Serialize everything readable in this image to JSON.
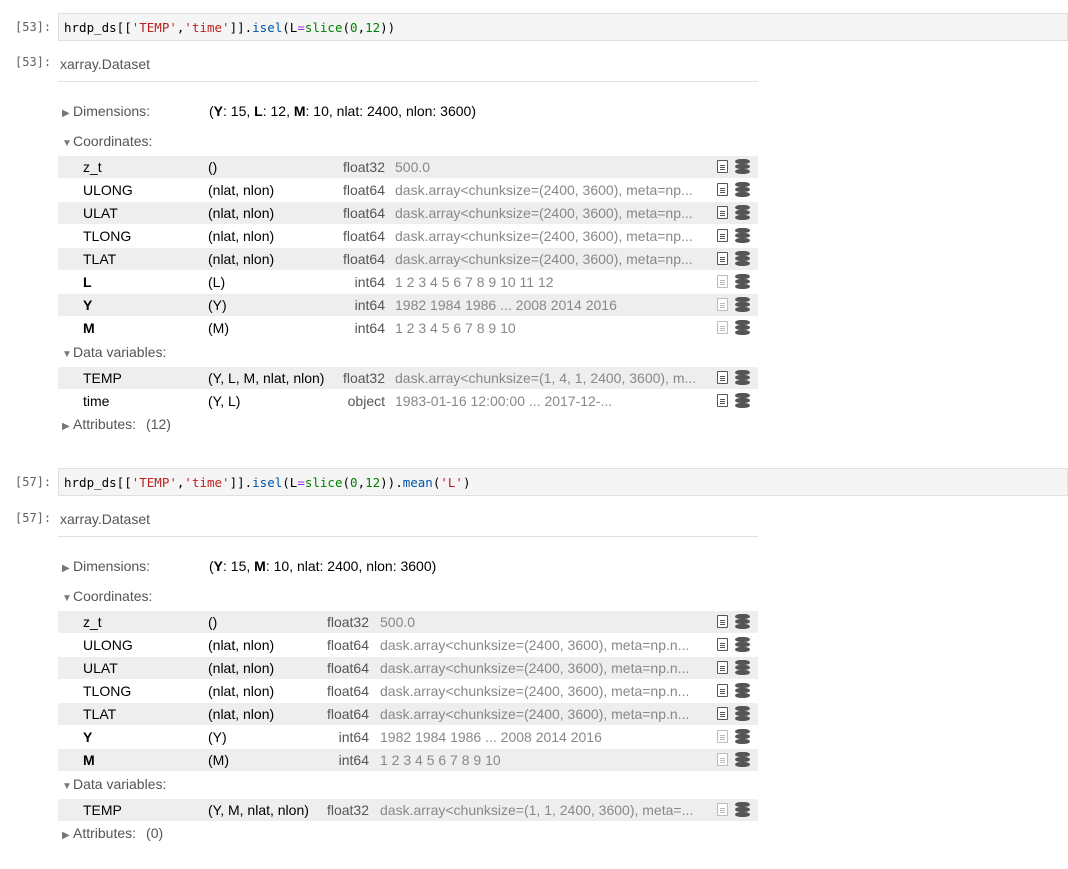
{
  "cells": [
    {
      "in_prompt": "[53]:",
      "out_prompt": "[53]:",
      "code_parts": [
        {
          "t": "hrdp_ds[[",
          "c": ""
        },
        {
          "t": "'TEMP'",
          "c": "c-str"
        },
        {
          "t": ",",
          "c": ""
        },
        {
          "t": "'time'",
          "c": "c-str"
        },
        {
          "t": "]].",
          "c": ""
        },
        {
          "t": "isel",
          "c": "c-fn"
        },
        {
          "t": "(L",
          "c": ""
        },
        {
          "t": "=",
          "c": "c-kw"
        },
        {
          "t": "slice",
          "c": "c-num"
        },
        {
          "t": "(",
          "c": ""
        },
        {
          "t": "0",
          "c": "c-num"
        },
        {
          "t": ",",
          "c": ""
        },
        {
          "t": "12",
          "c": "c-num"
        },
        {
          "t": "))",
          "c": ""
        }
      ],
      "output_title": "xarray.Dataset",
      "dimensions_label": "Dimensions:",
      "dimensions_parts": [
        {
          "t": "(",
          "b": false
        },
        {
          "t": "Y",
          "b": true
        },
        {
          "t": ": 15, ",
          "b": false
        },
        {
          "t": "L",
          "b": true
        },
        {
          "t": ": 12, ",
          "b": false
        },
        {
          "t": "M",
          "b": true
        },
        {
          "t": ": 10, nlat: 2400, nlon: 3600)",
          "b": false
        }
      ],
      "coordinates_label": "Coordinates:",
      "coordinates": [
        {
          "name": "z_t",
          "bold": false,
          "dims": "()",
          "dtype": "float32",
          "preview": "500.0",
          "doc_dark": true
        },
        {
          "name": "ULONG",
          "bold": false,
          "dims": "(nlat, nlon)",
          "dtype": "float64",
          "preview": "dask.array<chunksize=(2400, 3600), meta=np...",
          "doc_dark": true
        },
        {
          "name": "ULAT",
          "bold": false,
          "dims": "(nlat, nlon)",
          "dtype": "float64",
          "preview": "dask.array<chunksize=(2400, 3600), meta=np...",
          "doc_dark": true
        },
        {
          "name": "TLONG",
          "bold": false,
          "dims": "(nlat, nlon)",
          "dtype": "float64",
          "preview": "dask.array<chunksize=(2400, 3600), meta=np...",
          "doc_dark": true
        },
        {
          "name": "TLAT",
          "bold": false,
          "dims": "(nlat, nlon)",
          "dtype": "float64",
          "preview": "dask.array<chunksize=(2400, 3600), meta=np...",
          "doc_dark": true
        },
        {
          "name": "L",
          "bold": true,
          "dims": "(L)",
          "dtype": "int64",
          "preview": "1 2 3 4 5 6 7 8 9 10 11 12",
          "doc_dark": false
        },
        {
          "name": "Y",
          "bold": true,
          "dims": "(Y)",
          "dtype": "int64",
          "preview": "1982 1984 1986 ... 2008 2014 2016",
          "doc_dark": false
        },
        {
          "name": "M",
          "bold": true,
          "dims": "(M)",
          "dtype": "int64",
          "preview": "1 2 3 4 5 6 7 8 9 10",
          "doc_dark": false
        }
      ],
      "data_vars_label": "Data variables:",
      "data_vars": [
        {
          "name": "TEMP",
          "bold": false,
          "dims": "(Y, L, M, nlat, nlon)",
          "dtype": "float32",
          "preview": "dask.array<chunksize=(1, 4, 1, 2400, 3600), m...",
          "doc_dark": true
        },
        {
          "name": "time",
          "bold": false,
          "dims": "(Y, L)",
          "dtype": "object",
          "preview": "1983-01-16 12:00:00 ... 2017-12-...",
          "doc_dark": true
        }
      ],
      "attributes_label": "Attributes:",
      "attributes_count": "(12)"
    },
    {
      "in_prompt": "[57]:",
      "out_prompt": "[57]:",
      "code_parts": [
        {
          "t": "hrdp_ds[[",
          "c": ""
        },
        {
          "t": "'TEMP'",
          "c": "c-str"
        },
        {
          "t": ",",
          "c": ""
        },
        {
          "t": "'time'",
          "c": "c-str"
        },
        {
          "t": "]].",
          "c": ""
        },
        {
          "t": "isel",
          "c": "c-fn"
        },
        {
          "t": "(L",
          "c": ""
        },
        {
          "t": "=",
          "c": "c-kw"
        },
        {
          "t": "slice",
          "c": "c-num"
        },
        {
          "t": "(",
          "c": ""
        },
        {
          "t": "0",
          "c": "c-num"
        },
        {
          "t": ",",
          "c": ""
        },
        {
          "t": "12",
          "c": "c-num"
        },
        {
          "t": ")).",
          "c": ""
        },
        {
          "t": "mean",
          "c": "c-fn"
        },
        {
          "t": "(",
          "c": ""
        },
        {
          "t": "'L'",
          "c": "c-str"
        },
        {
          "t": ")",
          "c": ""
        }
      ],
      "output_title": "xarray.Dataset",
      "dimensions_label": "Dimensions:",
      "dimensions_parts": [
        {
          "t": "(",
          "b": false
        },
        {
          "t": "Y",
          "b": true
        },
        {
          "t": ": 15, ",
          "b": false
        },
        {
          "t": "M",
          "b": true
        },
        {
          "t": ": 10, nlat: 2400, nlon: 3600)",
          "b": false
        }
      ],
      "coordinates_label": "Coordinates:",
      "coordinates": [
        {
          "name": "z_t",
          "bold": false,
          "dims": "()",
          "dtype": "float32",
          "preview": "500.0",
          "doc_dark": true
        },
        {
          "name": "ULONG",
          "bold": false,
          "dims": "(nlat, nlon)",
          "dtype": "float64",
          "preview": "dask.array<chunksize=(2400, 3600), meta=np.n...",
          "doc_dark": true
        },
        {
          "name": "ULAT",
          "bold": false,
          "dims": "(nlat, nlon)",
          "dtype": "float64",
          "preview": "dask.array<chunksize=(2400, 3600), meta=np.n...",
          "doc_dark": true
        },
        {
          "name": "TLONG",
          "bold": false,
          "dims": "(nlat, nlon)",
          "dtype": "float64",
          "preview": "dask.array<chunksize=(2400, 3600), meta=np.n...",
          "doc_dark": true
        },
        {
          "name": "TLAT",
          "bold": false,
          "dims": "(nlat, nlon)",
          "dtype": "float64",
          "preview": "dask.array<chunksize=(2400, 3600), meta=np.n...",
          "doc_dark": true
        },
        {
          "name": "Y",
          "bold": true,
          "dims": "(Y)",
          "dtype": "int64",
          "preview": "1982 1984 1986 ... 2008 2014 2016",
          "doc_dark": false
        },
        {
          "name": "M",
          "bold": true,
          "dims": "(M)",
          "dtype": "int64",
          "preview": "1 2 3 4 5 6 7 8 9 10",
          "doc_dark": false
        }
      ],
      "data_vars_label": "Data variables:",
      "data_vars": [
        {
          "name": "TEMP",
          "bold": false,
          "dims": "(Y, M, nlat, nlon)",
          "dtype": "float32",
          "preview": "dask.array<chunksize=(1, 1, 2400, 3600), meta=...",
          "doc_dark": false
        }
      ],
      "attributes_label": "Attributes:",
      "attributes_count": "(0)"
    }
  ],
  "triangles": {
    "collapsed": "▶",
    "expanded": "▼"
  },
  "icons": {
    "attrs": "file-text-icon",
    "data": "database-icon"
  },
  "colors": {
    "input_bg": "#f5f5f5",
    "row_shade": "#eeeeee",
    "string": "#ba2121",
    "number": "#008000",
    "function": "#0055aa",
    "operator": "#aa22ff"
  }
}
